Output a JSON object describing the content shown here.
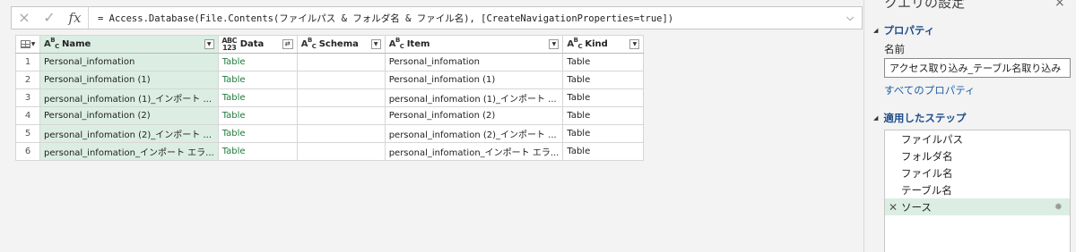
{
  "formula_bar": {
    "cancel_icon": "×",
    "confirm_icon": "✓",
    "fx_label": "fx",
    "formula": "= Access.Database(File.Contents(ファイルパス & フォルダ名 & ファイル名), [CreateNavigationProperties=true])",
    "expand_icon": "chevron-down-icon"
  },
  "grid": {
    "columns": [
      {
        "type": "ABC",
        "name": "Name"
      },
      {
        "type": "ABC123",
        "name": "Data"
      },
      {
        "type": "ABC",
        "name": "Schema"
      },
      {
        "type": "ABC",
        "name": "Item"
      },
      {
        "type": "ABC",
        "name": "Kind"
      }
    ],
    "rows": [
      {
        "n": "1",
        "name": "Personal_infomation",
        "data": "Table",
        "schema": "",
        "item": "Personal_infomation",
        "kind": "Table"
      },
      {
        "n": "2",
        "name": "Personal_infomation (1)",
        "data": "Table",
        "schema": "",
        "item": "Personal_infomation (1)",
        "kind": "Table"
      },
      {
        "n": "3",
        "name": "personal_infomation (1)_インポート ...",
        "data": "Table",
        "schema": "",
        "item": "personal_infomation (1)_インポート ...",
        "kind": "Table"
      },
      {
        "n": "4",
        "name": "Personal_infomation (2)",
        "data": "Table",
        "schema": "",
        "item": "Personal_infomation (2)",
        "kind": "Table"
      },
      {
        "n": "5",
        "name": "personal_infomation (2)_インポート ...",
        "data": "Table",
        "schema": "",
        "item": "personal_infomation (2)_インポート ...",
        "kind": "Table"
      },
      {
        "n": "6",
        "name": "personal_infomation_インポート エラ...",
        "data": "Table",
        "schema": "",
        "item": "personal_infomation_インポート エラ...",
        "kind": "Table"
      }
    ]
  },
  "query_settings": {
    "title": "クエリの設定",
    "close_icon": "×",
    "properties_header": "プロパティ",
    "name_label": "名前",
    "name_value": "アクセス取り込み_テーブル名取り込み",
    "all_properties_link": "すべてのプロパティ",
    "applied_steps_header": "適用したステップ",
    "steps": [
      {
        "label": "ファイルパス",
        "active": false
      },
      {
        "label": "フォルダ名",
        "active": false
      },
      {
        "label": "ファイル名",
        "active": false
      },
      {
        "label": "テーブル名",
        "active": false
      },
      {
        "label": "ソース",
        "active": true
      }
    ]
  },
  "colors": {
    "selected_column": "#dceee3",
    "table_link": "#1e7b3a",
    "section_header": "#1f4e8c",
    "link": "#1f5fa8"
  }
}
